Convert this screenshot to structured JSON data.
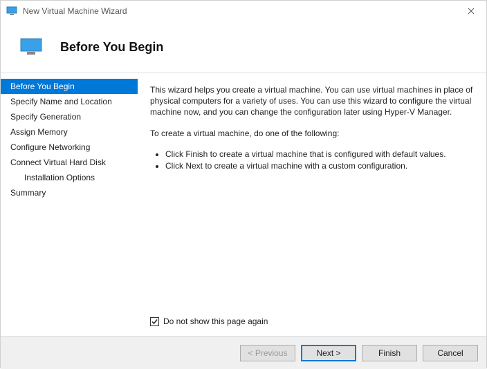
{
  "window": {
    "title": "New Virtual Machine Wizard"
  },
  "header": {
    "title": "Before You Begin"
  },
  "sidebar": {
    "items": [
      {
        "label": "Before You Begin",
        "active": true
      },
      {
        "label": "Specify Name and Location"
      },
      {
        "label": "Specify Generation"
      },
      {
        "label": "Assign Memory"
      },
      {
        "label": "Configure Networking"
      },
      {
        "label": "Connect Virtual Hard Disk"
      },
      {
        "label": "Installation Options",
        "sub": true
      },
      {
        "label": "Summary"
      }
    ]
  },
  "content": {
    "intro": "This wizard helps you create a virtual machine. You can use virtual machines in place of physical computers for a variety of uses. You can use this wizard to configure the virtual machine now, and you can change the configuration later using Hyper-V Manager.",
    "instruction": "To create a virtual machine, do one of the following:",
    "bullets": [
      "Click Finish to create a virtual machine that is configured with default values.",
      "Click Next to create a virtual machine with a custom configuration."
    ],
    "checkbox_label": "Do not show this page again",
    "checkbox_checked": true
  },
  "footer": {
    "previous": "< Previous",
    "next": "Next >",
    "finish": "Finish",
    "cancel": "Cancel"
  }
}
